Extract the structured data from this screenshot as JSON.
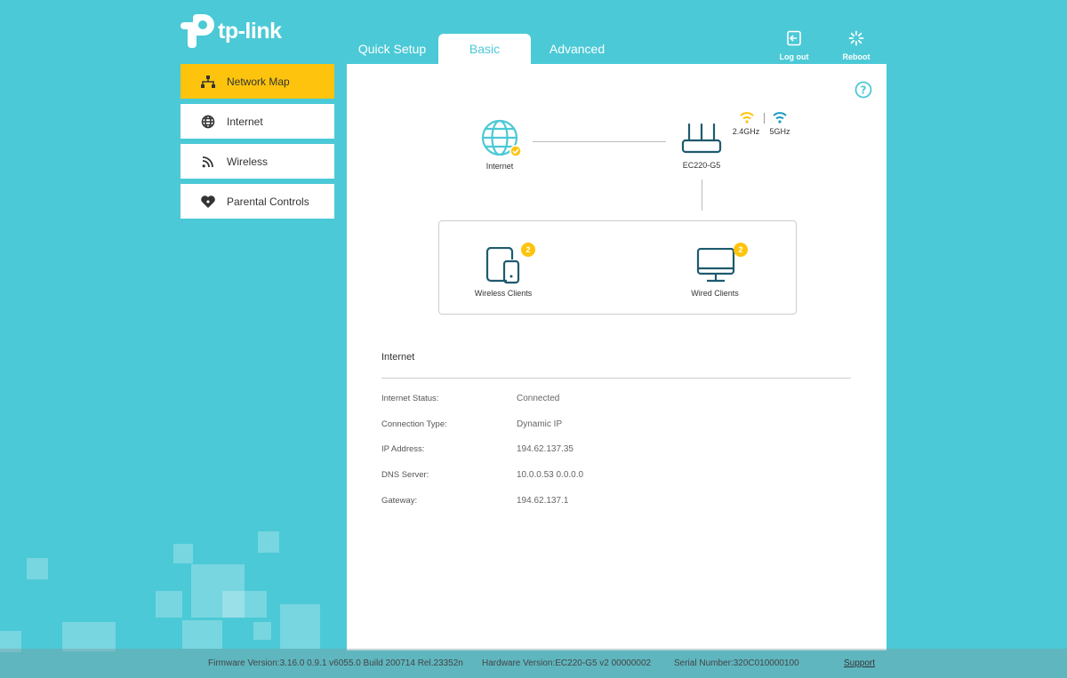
{
  "brand": {
    "logo_text": "tp-link"
  },
  "tabs": [
    {
      "label": "Quick Setup"
    },
    {
      "label": "Basic"
    },
    {
      "label": "Advanced"
    }
  ],
  "top_actions": {
    "logout_label": "Log out",
    "reboot_label": "Reboot"
  },
  "sidebar": {
    "items": [
      {
        "label": "Network Map",
        "icon": "network-icon"
      },
      {
        "label": "Internet",
        "icon": "globe-icon"
      },
      {
        "label": "Wireless",
        "icon": "wifi-icon"
      },
      {
        "label": "Parental Controls",
        "icon": "heart-icon"
      }
    ]
  },
  "map": {
    "internet_label": "Internet",
    "router_label": "EC220-G5",
    "band_24": "2.4GHz",
    "band_5": "5GHz",
    "wireless_clients_label": "Wireless Clients",
    "wireless_clients_count": "2",
    "wired_clients_label": "Wired Clients",
    "wired_clients_count": "2"
  },
  "internet_info": {
    "title": "Internet",
    "rows": [
      {
        "key": "Internet Status:",
        "value": "Connected"
      },
      {
        "key": "Connection Type:",
        "value": "Dynamic IP"
      },
      {
        "key": "IP Address:",
        "value": "194.62.137.35"
      },
      {
        "key": "DNS Server:",
        "value": "10.0.0.53 0.0.0.0"
      },
      {
        "key": "Gateway:",
        "value": "194.62.137.1"
      }
    ]
  },
  "footer": {
    "firmware": "Firmware Version:3.16.0 0.9.1 v6055.0 Build 200714 Rel.23352n",
    "hardware": "Hardware Version:EC220-G5 v2 00000002",
    "serial": "Serial Number:320C010000100",
    "support": "Support"
  },
  "colors": {
    "accent": "#4bc9d6",
    "highlight": "#fec40d",
    "icon_dark": "#1e5a6e"
  }
}
